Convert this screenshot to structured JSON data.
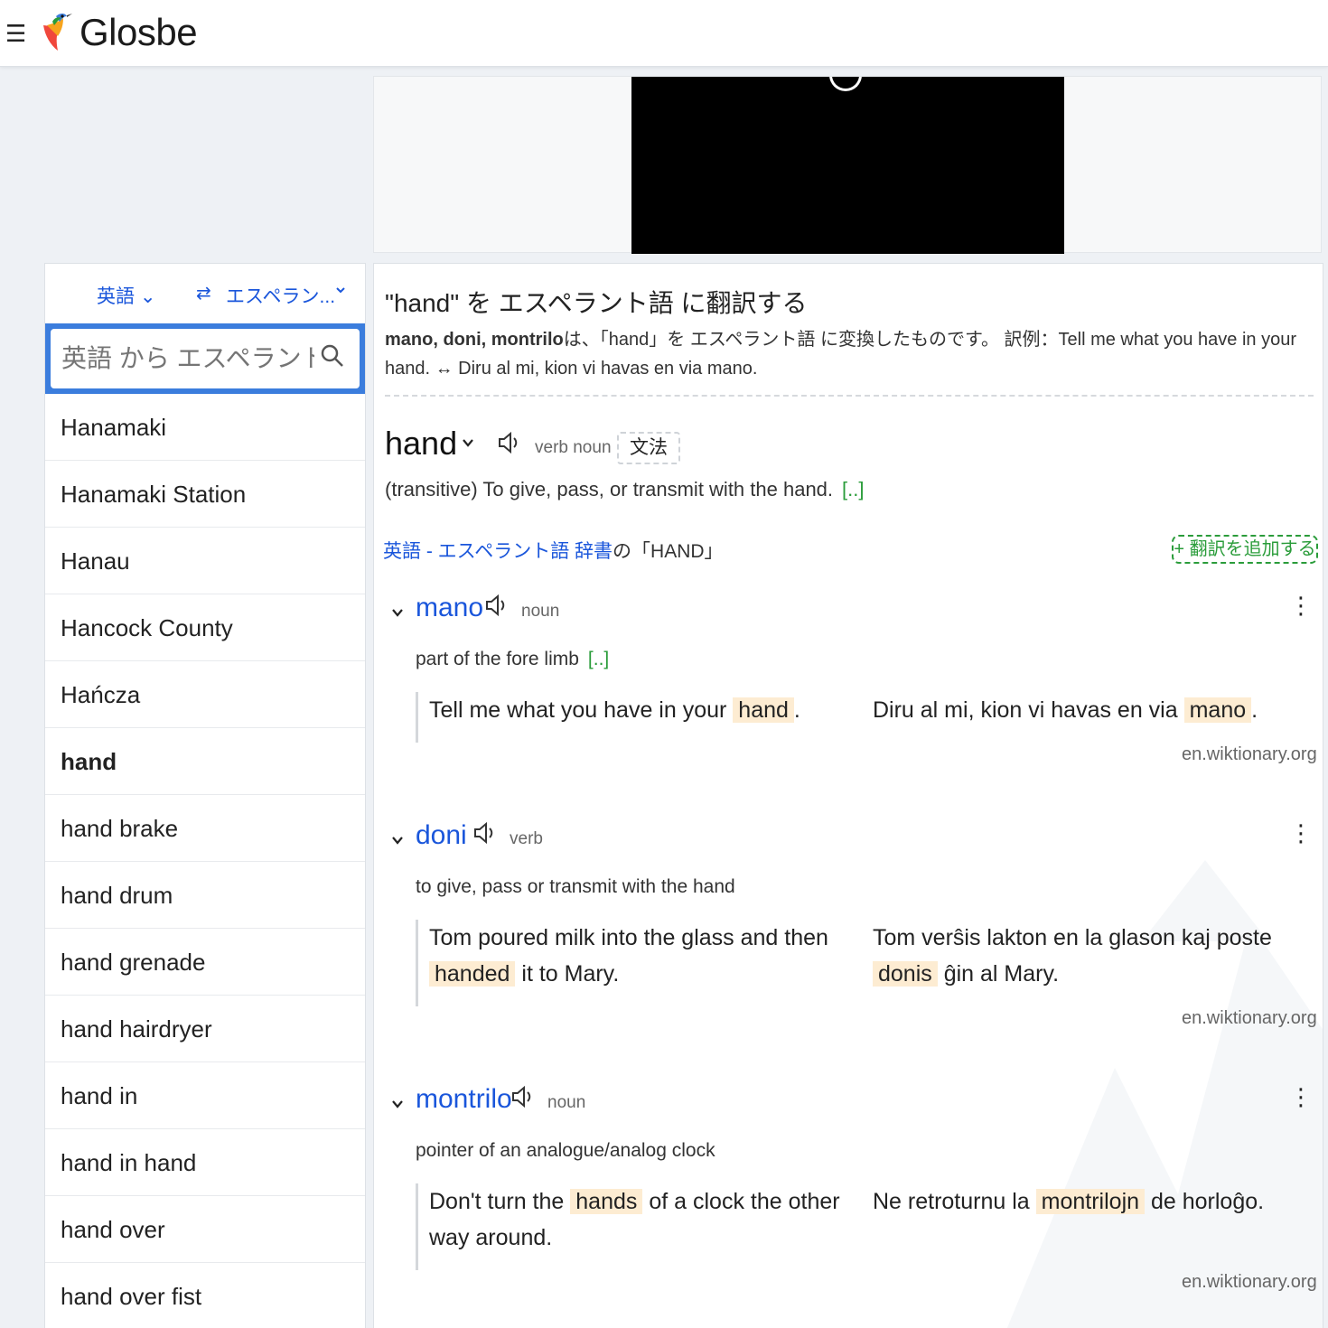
{
  "header": {
    "menu_icon": "hamburger-icon",
    "brand": "Glosbe",
    "logo_icon": "hummingbird-logo-icon"
  },
  "sidebar": {
    "source_lang": "英語 ⌄",
    "target_lang": "エスペラン...",
    "search_placeholder": "英語 から エスペラント語 へ",
    "items": [
      {
        "label": "Hanamaki"
      },
      {
        "label": "Hanamaki Station"
      },
      {
        "label": "Hanau"
      },
      {
        "label": "Hancock County"
      },
      {
        "label": "Hańcza"
      },
      {
        "label": "hand"
      },
      {
        "label": "hand brake"
      },
      {
        "label": "hand drum"
      },
      {
        "label": "hand grenade"
      },
      {
        "label": "hand hairdryer"
      },
      {
        "label": "hand in"
      },
      {
        "label": "hand in hand"
      },
      {
        "label": "hand over"
      },
      {
        "label": "hand over fist"
      }
    ],
    "active_item": "hand"
  },
  "main": {
    "title": "\"hand\" を エスペラント語 に翻訳する",
    "summary_bold": "mano, doni, montrilo",
    "summary_text": "は、「hand」を エスペラント語 に変換したものです。 訳例：Tell me what you have in your hand. ↔ Diru al mi, kion vi havas en via mano.",
    "headword": "hand",
    "headword_pos": "verb noun",
    "grammar_label": "文法",
    "headword_definition": "(transitive) To give, pass, or transmit with the hand.",
    "more_label": "[..]",
    "dict_label_link": "英語 - エスペラント語 辞書",
    "dict_label_rest": "の「HAND」",
    "add_translation": "+ 翻訳を追加する",
    "entries": [
      {
        "word": "mano",
        "pos": "noun",
        "definition": "part of the fore limb",
        "ex_src_before": "Tell me what you have in your",
        "ex_src_hl": "hand",
        "ex_src_after": ".",
        "ex_tgt_before": "Diru al mi, kion vi havas en via",
        "ex_tgt_hl": "mano",
        "ex_tgt_after": ".",
        "source": "en.wiktionary.org"
      },
      {
        "word": "doni",
        "pos": "verb",
        "definition": "to give, pass or transmit with the hand",
        "ex_src_before": "Tom poured milk into the glass and then",
        "ex_src_hl": "handed",
        "ex_src_after": "it to Mary.",
        "ex_tgt_before": "Tom verŝis lakton en la glason kaj poste",
        "ex_tgt_hl": "donis",
        "ex_tgt_after": "ĝin al Mary.",
        "source": "en.wiktionary.org"
      },
      {
        "word": "montrilo",
        "pos": "noun",
        "definition": "pointer of an analogue/analog clock",
        "ex_src_before": "Don't turn the",
        "ex_src_hl": "hands",
        "ex_src_after": "of a clock the other way around.",
        "ex_tgt_before": "Ne retroturnu la",
        "ex_tgt_hl": "montrilojn",
        "ex_tgt_after": "de horloĝo.",
        "source": "en.wiktionary.org"
      }
    ]
  },
  "colors": {
    "link": "#1a56db",
    "green": "#2a9c3a",
    "highlight": "#fdecd2",
    "search_border": "#3b7ddd"
  }
}
